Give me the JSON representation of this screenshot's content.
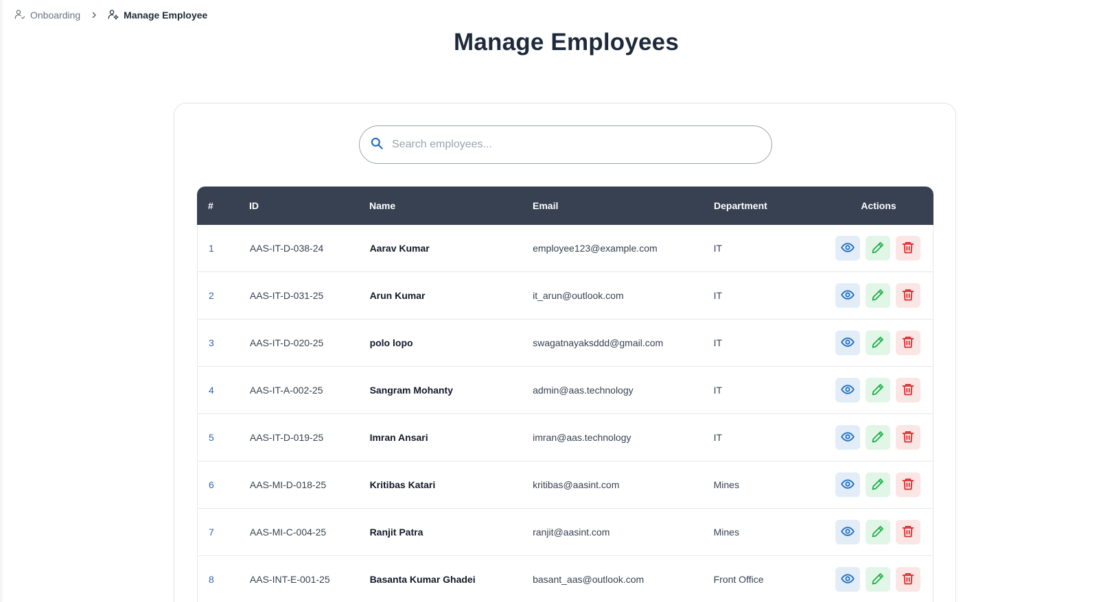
{
  "breadcrumb": {
    "items": [
      {
        "label": "Onboarding",
        "icon": "user-check-icon"
      },
      {
        "label": "Manage Employee",
        "icon": "user-cog-icon"
      }
    ],
    "separator_icon": "chevron-right-icon"
  },
  "page_title": "Manage Employees",
  "search": {
    "placeholder": "Search employees...",
    "value": "",
    "icon": "search-icon"
  },
  "table": {
    "headers": {
      "num": "#",
      "id": "ID",
      "name": "Name",
      "email": "Email",
      "department": "Department",
      "actions": "Actions"
    },
    "rows": [
      {
        "num": "1",
        "id": "AAS-IT-D-038-24",
        "name": "Aarav Kumar",
        "email": "employee123@example.com",
        "department": "IT"
      },
      {
        "num": "2",
        "id": "AAS-IT-D-031-25",
        "name": "Arun Kumar",
        "email": "it_arun@outlook.com",
        "department": "IT"
      },
      {
        "num": "3",
        "id": "AAS-IT-D-020-25",
        "name": "polo lopo",
        "email": "swagatnayaksddd@gmail.com",
        "department": "IT"
      },
      {
        "num": "4",
        "id": "AAS-IT-A-002-25",
        "name": "Sangram Mohanty",
        "email": "admin@aas.technology",
        "department": "IT"
      },
      {
        "num": "5",
        "id": "AAS-IT-D-019-25",
        "name": "Imran Ansari",
        "email": "imran@aas.technology",
        "department": "IT"
      },
      {
        "num": "6",
        "id": "AAS-MI-D-018-25",
        "name": "Kritibas Katari",
        "email": "kritibas@aasint.com",
        "department": "Mines"
      },
      {
        "num": "7",
        "id": "AAS-MI-C-004-25",
        "name": "Ranjit Patra",
        "email": "ranjit@aasint.com",
        "department": "Mines"
      },
      {
        "num": "8",
        "id": "AAS-INT-E-001-25",
        "name": "Basanta Kumar Ghadei",
        "email": "basant_aas@outlook.com",
        "department": "Front Office"
      }
    ],
    "action_icons": [
      "eye-icon",
      "pencil-icon",
      "trash-icon"
    ]
  },
  "colors": {
    "header_bg": "#374151",
    "view": "#1e6fc0",
    "edit": "#22b04b",
    "delete": "#d92d2d",
    "row_number": "#2f64b0"
  }
}
